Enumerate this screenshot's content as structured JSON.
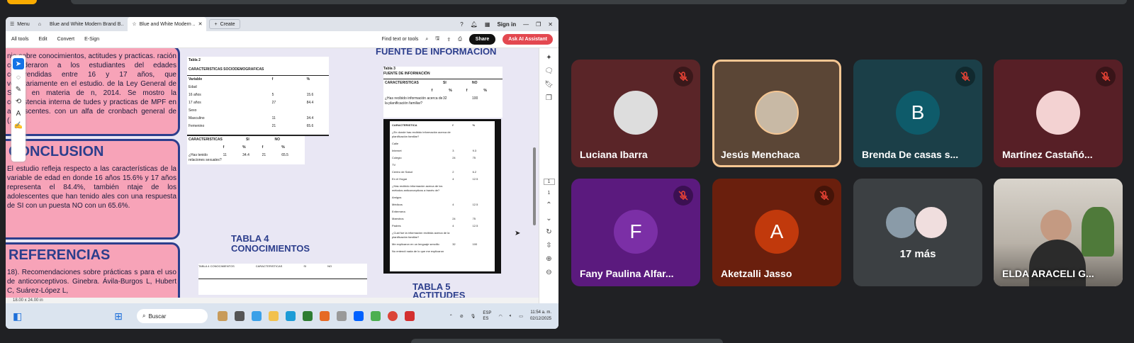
{
  "shared_screen": {
    "menu_label": "Menu",
    "tabs": [
      {
        "label": "Blue and White Modern Brand B.."
      },
      {
        "label": "Blue and White Modern .."
      }
    ],
    "create_label": "Create",
    "sign_in": "Sign in",
    "toolbar": {
      "all_tools": "All tools",
      "edit": "Edit",
      "convert": "Convert",
      "esign": "E-Sign",
      "find": "Find text or tools",
      "share": "Share",
      "ask_ai": "Ask AI Assistant"
    },
    "poster": {
      "intro_text": "nio sobre conocimientos, actitudes y practicas. ración consideraron a los estudiantes del edades comprendidas entre 16 y 17 años, que voluntariamente en el estudio. de la Ley General de Salud en materia de n, 2014. Se mostro la consistencia interna de tudes y practicas de MPF en adolescentes. con un alfa de cronbach general de (.64).",
      "conclusion_title": "CONCLUSION",
      "conclusion_text": "El estudio refleja respecto a las características de la variable de edad en donde 16 años 15.6% y 17 años representa el 84.4%, también ntaje de los adolescentes que han tenido ales con una respuesta de SI con un puesta NO con un 65.6%.",
      "referencias_title": "REFERENCIAS",
      "referencias_text": "18). Recomendaciones sobre prácticas s para el uso de anticonceptivos. Ginebra. Ávila-Burgos L, Hubert C, Suárez-López L,",
      "fuente_title": "FUENTE DE INFORMACION",
      "tabla4_title": "TABLA 4\nCONOCIMIENTOS",
      "tabla5_title": "TABLA 5",
      "tabla5_sub": "ACTITUDES",
      "tabla2": {
        "label": "Tabla 2",
        "title": "CARACTERISTICAS SOCIODEMOGRAFICAS",
        "headers": [
          "Variable",
          "f",
          "%"
        ],
        "rows": [
          [
            "Edad",
            "",
            ""
          ],
          [
            "16 años",
            "5",
            "15.6"
          ],
          [
            "17 años",
            "27",
            "84.4"
          ],
          [
            "Sexo",
            "",
            ""
          ],
          [
            "Masculino",
            "11",
            "34.4"
          ],
          [
            "Femenino",
            "21",
            "65.6"
          ]
        ],
        "sub_header": [
          "CARACTERISTICAS",
          "SI",
          "NO"
        ],
        "sub_cols": [
          "f",
          "%",
          "f",
          "%"
        ],
        "sub_row": [
          "¿Has tenido relaciones sexuales?",
          "11",
          "34.4",
          "21",
          "65.5"
        ]
      },
      "tabla3": {
        "label": "Tabla 3",
        "title": "FUENTE DE INFORMACIÓN",
        "headers": [
          "CARACTERISTICAS",
          "SI",
          "NO"
        ],
        "cols": [
          "f",
          "%",
          "f",
          "%"
        ],
        "row": [
          "¿Has recibido información acerca de la planificación familiar?",
          "32",
          "100"
        ]
      },
      "dark_table": {
        "header": [
          "CARACTERISTICA",
          "f",
          "%"
        ],
        "rows": [
          [
            "¿En donde has recibido información acerca de planificación familiar?",
            "",
            ""
          ],
          [
            "Calle",
            "",
            ""
          ],
          [
            "Internet",
            "3",
            "9.3"
          ],
          [
            "Colegio",
            "24",
            "75"
          ],
          [
            "TV",
            "",
            ""
          ],
          [
            "Centro de Salud",
            "2",
            "6.2"
          ],
          [
            "En el Hogar",
            "4",
            "12.5"
          ],
          [
            "¿Has recibido información acerca de los métodos anticonceptivos a través de?",
            "",
            ""
          ],
          [
            "Amigos",
            "",
            ""
          ],
          [
            "Médicos",
            "4",
            "12.5"
          ],
          [
            "Enfermera",
            "",
            ""
          ],
          [
            "Maestros",
            "24",
            "75"
          ],
          [
            "Padres",
            "4",
            "12.5"
          ],
          [
            "¿Cuál fue la información recibida acerca de la planificación familiar?",
            "",
            ""
          ],
          [
            "Me explicaron en un lenguaje sencillo",
            "32",
            "100"
          ],
          [
            "No entendí nada de lo que me explicaron",
            "",
            ""
          ]
        ]
      },
      "tabla4_cols": [
        "TABLA 4 CONOCIMIENTOS",
        "CARACTERISTICAS",
        "SI",
        "NO"
      ]
    },
    "status_size": "18.00 x 24.00 in",
    "page_indicator": [
      "1",
      "1"
    ],
    "taskbar": {
      "search": "Buscar",
      "lang": "ESP\nES",
      "time": "11:54 a. m.",
      "date": "02/12/2025"
    }
  },
  "participants": [
    {
      "name": "Luciana Ibarra",
      "muted": true,
      "bg": "#5a2528",
      "avatar_type": "photo",
      "avatar_color": "#ddd"
    },
    {
      "name": "Jesús Menchaca",
      "muted": false,
      "bg": "#5b4636",
      "avatar_type": "photo",
      "avatar_color": "#c8b9a5",
      "speaking": true
    },
    {
      "name": "Brenda De casas s...",
      "muted": true,
      "bg": "#1b3f48",
      "avatar_type": "letter",
      "letter": "B",
      "avatar_color": "#0e5b6a"
    },
    {
      "name": "Martínez Castañó...",
      "muted": true,
      "bg": "#571f26",
      "avatar_type": "photo",
      "avatar_color": "#f3d2d2"
    },
    {
      "name": "Fany Paulina Alfar...",
      "muted": true,
      "bg": "#5b1a7e",
      "avatar_type": "letter",
      "letter": "F",
      "avatar_color": "#7b2fa6"
    },
    {
      "name": "Aketzalli Jasso",
      "muted": true,
      "bg": "#6a1f0d",
      "avatar_type": "letter",
      "letter": "A",
      "avatar_color": "#c1390c"
    },
    {
      "name": "",
      "more": "17 más",
      "bg": "#3c4043"
    },
    {
      "name": "ELDA ARACELI G...",
      "muted": false,
      "bg": "#c9c4bd",
      "video": true
    }
  ],
  "colors": {
    "meet_bg": "#202124",
    "poster_blue": "#2c3e8c",
    "poster_pink": "#f7a3b8",
    "muted_icon": "#ea4335"
  }
}
